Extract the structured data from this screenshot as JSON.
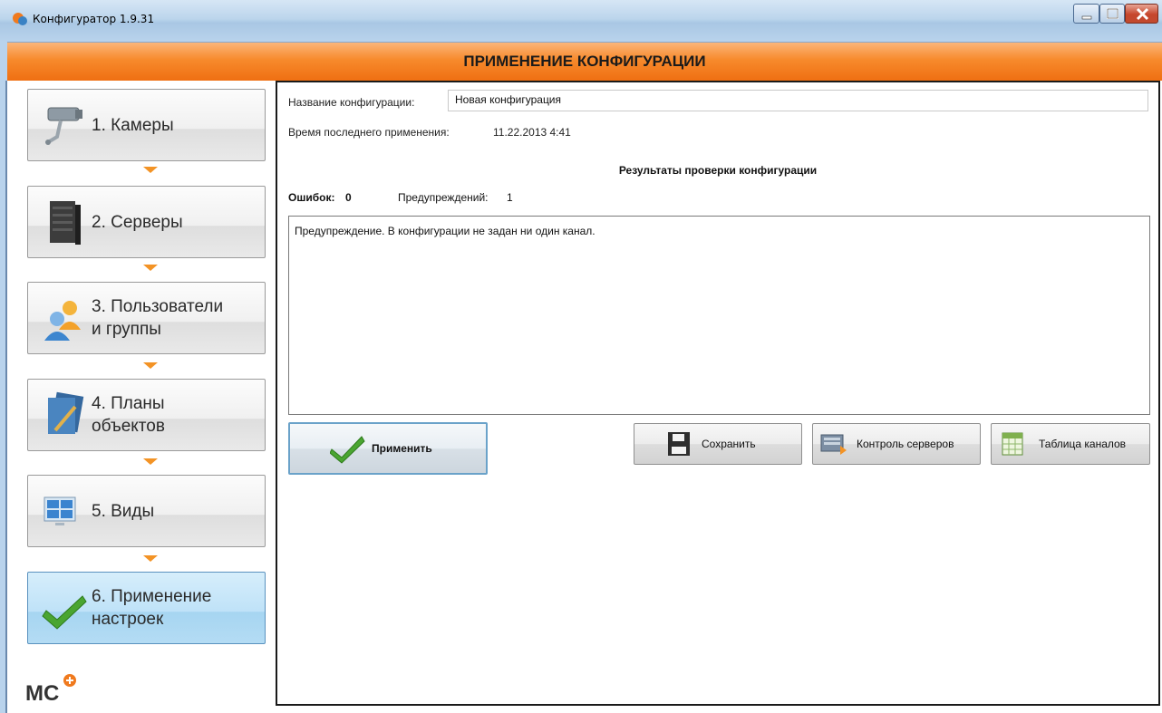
{
  "window": {
    "title": "Конфигуратор 1.9.31"
  },
  "header": {
    "title": "ПРИМЕНЕНИЕ КОНФИГУРАЦИИ"
  },
  "sidebar": {
    "steps": [
      {
        "label": "1. Камеры",
        "icon": "camera-icon"
      },
      {
        "label": "2. Серверы",
        "icon": "server-icon"
      },
      {
        "label": "3. Пользователи\nи группы",
        "icon": "users-icon"
      },
      {
        "label": "4. Планы\nобъектов",
        "icon": "plans-icon"
      },
      {
        "label": "5. Виды",
        "icon": "views-icon"
      },
      {
        "label": "6. Применение\nнастроек",
        "icon": "checkmark-icon",
        "active": true
      }
    ],
    "logo_text": "MC"
  },
  "main": {
    "name_label": "Название конфигурации:",
    "name_value": "Новая конфигурация",
    "time_label": "Время последнего применения:",
    "time_value": "11.22.2013 4:41",
    "results_title": "Результаты проверки конфигурации",
    "errors_label": "Ошибок:",
    "errors_count": "0",
    "warnings_label": "Предупреждений:",
    "warnings_count": "1",
    "log_text": "Предупреждение. В конфигурации не задан ни один канал."
  },
  "buttons": {
    "apply": "Применить",
    "save": "Сохранить",
    "servers_control": "Контроль серверов",
    "channels_table": "Таблица каналов"
  },
  "colors": {
    "accent_orange": "#f78a2c",
    "active_step": "#bfe2f8",
    "arrow": "#f39325"
  }
}
